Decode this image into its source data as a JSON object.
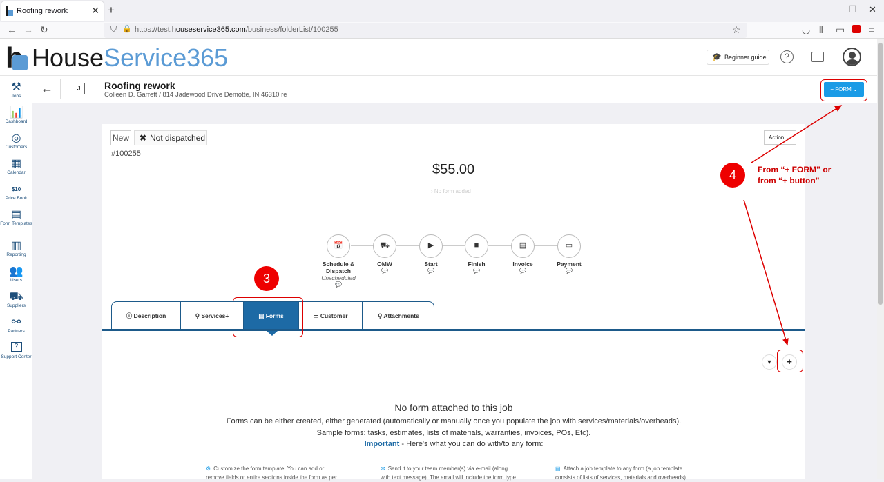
{
  "browser": {
    "tab_title": "Roofing rework",
    "url_prefix": "https://test.",
    "url_domain": "houseservice365.com",
    "url_path": "/business/folderList/100255"
  },
  "app": {
    "logo_part1": "House",
    "logo_part2": "Service365",
    "beginner_guide": "Beginner guide"
  },
  "sidebar": [
    {
      "icon": "jobs-icon",
      "glyph": "⚒",
      "label": "Jobs"
    },
    {
      "icon": "dashboard-icon",
      "glyph": "📊",
      "label": "Dashboard"
    },
    {
      "icon": "customers-icon",
      "glyph": "◎",
      "label": "Customers"
    },
    {
      "icon": "calendar-icon",
      "glyph": "▦",
      "label": "Calendar"
    },
    {
      "icon": "price-book-icon",
      "glyph": "$10",
      "label": "Price Book"
    },
    {
      "icon": "form-templates-icon",
      "glyph": "▤",
      "label": "Form Templates"
    },
    {
      "icon": "reporting-icon",
      "glyph": "▥",
      "label": "Reporting"
    },
    {
      "icon": "users-icon",
      "glyph": "👥",
      "label": "Users"
    },
    {
      "icon": "suppliers-icon",
      "glyph": "⛟",
      "label": "Suppliers"
    },
    {
      "icon": "partners-icon",
      "glyph": "⚯",
      "label": "Partners"
    },
    {
      "icon": "support-icon",
      "glyph": "?",
      "label": "Support Center"
    }
  ],
  "job": {
    "badge": "J",
    "title": "Roofing rework",
    "subtitle": "Colleen D. Garrett / 814 Jadewood Drive Demotte, IN 46310 re",
    "form_button": "+ FORM ⌄",
    "status_new": "New",
    "status_dispatch": "Not dispatched",
    "number": "#100255",
    "action": "Action ⌄",
    "price": "$55.00",
    "no_form_added": "› No form added"
  },
  "steps": [
    {
      "glyph": "📅",
      "label": "Schedule & Dispatch",
      "sub": "Unscheduled"
    },
    {
      "glyph": "⛟",
      "label": "OMW",
      "sub": ""
    },
    {
      "glyph": "▶",
      "label": "Start",
      "sub": ""
    },
    {
      "glyph": "■",
      "label": "Finish",
      "sub": ""
    },
    {
      "glyph": "▤",
      "label": "Invoice",
      "sub": ""
    },
    {
      "glyph": "▭",
      "label": "Payment",
      "sub": ""
    }
  ],
  "tabs": [
    {
      "label": "ⓘ  Description"
    },
    {
      "label": "⚲  Services+"
    },
    {
      "label": "▤  Forms"
    },
    {
      "label": "▭  Customer"
    },
    {
      "label": "⚲  Attachments"
    }
  ],
  "empty": {
    "title": "No form attached to this job",
    "line1": "Forms can be either created, either generated (automatically or manually once you populate the job with services/materials/overheads).",
    "line2": "Sample forms: tasks, estimates, lists of materials, warranties, invoices, POs, Etc).",
    "important": "Important",
    "line3": " - Here's what you can do with/to any form:",
    "col1a": "Customize the form template. You can add or",
    "col1b": "remove fields or entire sections inside the form as per",
    "col2a": "Send it to your team member(s) via e-mail (along",
    "col2b": "with text message). The email will include the form type",
    "col3a": "Attach a job template to any form (a job template",
    "col3b": "consists of lists of services, materials and overheads)"
  },
  "annotations": {
    "step3": "3",
    "step4": "4",
    "note": "From “+ FORM” or\nfrom “+ button”",
    "color": "#dd0000"
  }
}
